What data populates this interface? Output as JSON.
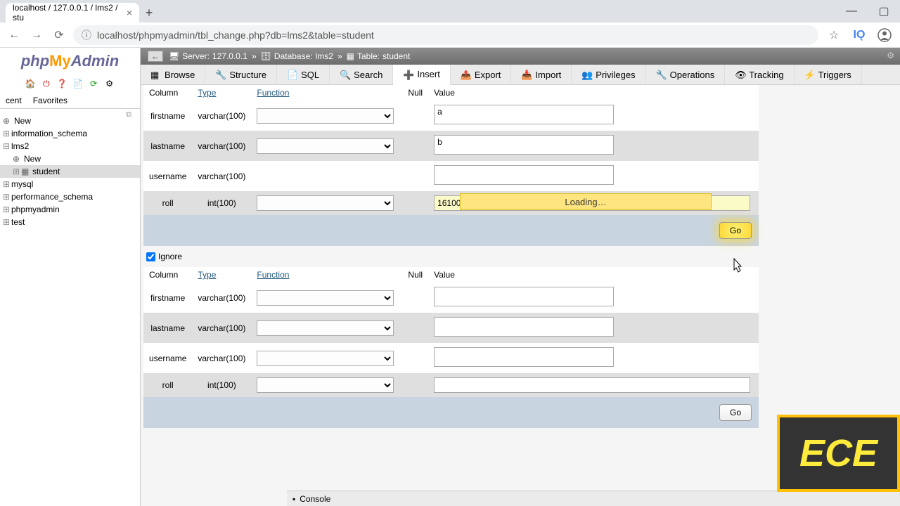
{
  "browser": {
    "tab_title": "localhost / 127.0.0.1 / lms2 / stu",
    "url": "localhost/phpmyadmin/tbl_change.php?db=lms2&table=student"
  },
  "logo": {
    "php": "php",
    "my": "My",
    "admin": "Admin"
  },
  "side_tabs": {
    "recent": "cent",
    "favorites": "Favorites"
  },
  "tree": {
    "new": "New",
    "info_schema": "information_schema",
    "lms2": "lms2",
    "lms2_new": "New",
    "student": "student",
    "mysql": "mysql",
    "perf_schema": "performance_schema",
    "phpmyadmin": "phpmyadmin",
    "test": "test"
  },
  "breadcrumb": {
    "server_label": "Server:",
    "server": "127.0.0.1",
    "db_label": "Database:",
    "db": "lms2",
    "table_label": "Table:",
    "table": "student"
  },
  "tabs": {
    "browse": "Browse",
    "structure": "Structure",
    "sql": "SQL",
    "search": "Search",
    "insert": "Insert",
    "export": "Export",
    "import": "Import",
    "privileges": "Privileges",
    "operations": "Operations",
    "tracking": "Tracking",
    "triggers": "Triggers"
  },
  "headers": {
    "column": "Column",
    "type": "Type",
    "function": "Function",
    "null": "Null",
    "value": "Value"
  },
  "row1": {
    "firstname": {
      "col": "firstname",
      "type": "varchar(100)",
      "val": "a"
    },
    "lastname": {
      "col": "lastname",
      "type": "varchar(100)",
      "val": "b"
    },
    "username": {
      "col": "username",
      "type": "varchar(100)",
      "val": ""
    },
    "roll": {
      "col": "roll",
      "type": "int(100)",
      "val": "1610045"
    }
  },
  "row2": {
    "firstname": {
      "col": "firstname",
      "type": "varchar(100)",
      "val": ""
    },
    "lastname": {
      "col": "lastname",
      "type": "varchar(100)",
      "val": ""
    },
    "username": {
      "col": "username",
      "type": "varchar(100)",
      "val": ""
    },
    "roll": {
      "col": "roll",
      "type": "int(100)",
      "val": ""
    }
  },
  "ignore_label": "Ignore",
  "go_label": "Go",
  "loading_text": "Loading…",
  "console_label": "Console",
  "watermark": "ECE"
}
